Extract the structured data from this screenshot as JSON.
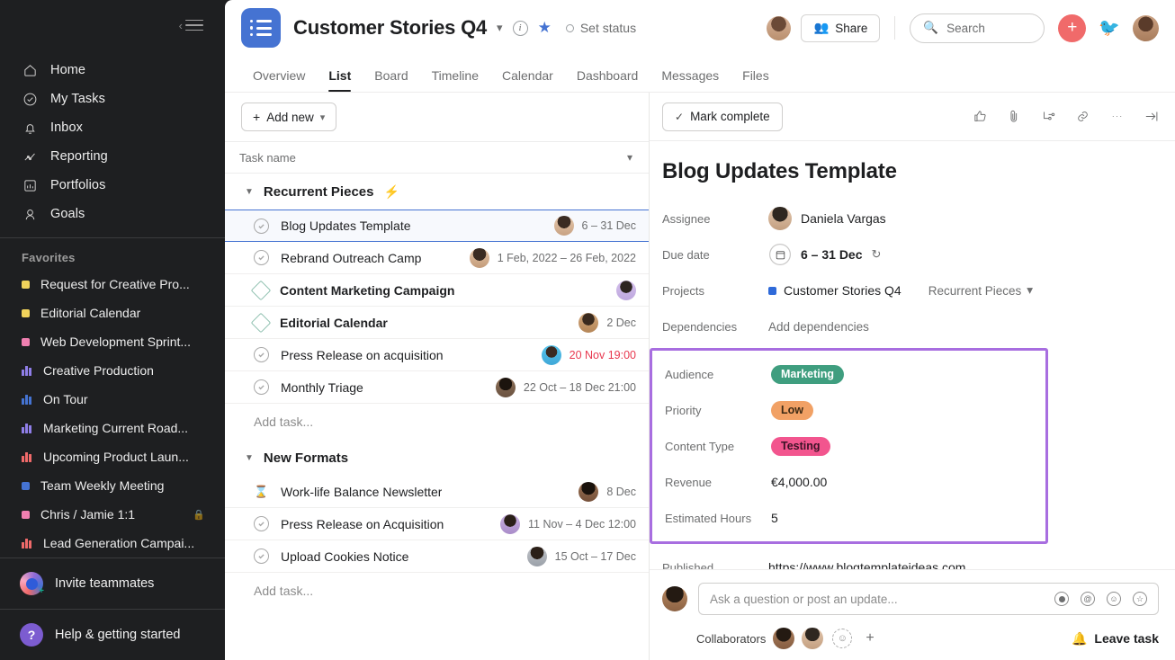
{
  "sidebar": {
    "collapse_label": "Collapse sidebar",
    "nav": [
      {
        "label": "Home",
        "icon": "home-icon"
      },
      {
        "label": "My Tasks",
        "icon": "check-circle-icon"
      },
      {
        "label": "Inbox",
        "icon": "bell-icon"
      },
      {
        "label": "Reporting",
        "icon": "chart-line-icon"
      },
      {
        "label": "Portfolios",
        "icon": "portfolio-icon"
      },
      {
        "label": "Goals",
        "icon": "goal-icon"
      }
    ],
    "favorites_title": "Favorites",
    "favorites": [
      {
        "label": "Request for Creative Pro...",
        "marker": "dot",
        "color": "#f1d35b"
      },
      {
        "label": "Editorial Calendar",
        "marker": "dot",
        "color": "#f1d35b"
      },
      {
        "label": "Web Development Sprint...",
        "marker": "dot",
        "color": "#ef7fb0"
      },
      {
        "label": "Creative Production",
        "marker": "bars",
        "color": "#8f7ee8"
      },
      {
        "label": "On Tour",
        "marker": "bars",
        "color": "#4573d2"
      },
      {
        "label": "Marketing Current Road...",
        "marker": "bars",
        "color": "#8f7ee8"
      },
      {
        "label": "Upcoming Product Laun...",
        "marker": "bars",
        "color": "#f06a6a"
      },
      {
        "label": "Team Weekly Meeting",
        "marker": "dot",
        "color": "#4573d2"
      },
      {
        "label": "Chris / Jamie 1:1",
        "marker": "dot",
        "color": "#ef7fb0",
        "locked": true
      },
      {
        "label": "Lead Generation Campai...",
        "marker": "bars",
        "color": "#f06a6a"
      }
    ],
    "invite_label": "Invite teammates",
    "help_label": "Help & getting started",
    "help_glyph": "?"
  },
  "header": {
    "project_title": "Customer Stories Q4",
    "set_status": "Set status",
    "share_label": "Share",
    "search_placeholder": "Search",
    "tabs": [
      {
        "label": "Overview",
        "active": false
      },
      {
        "label": "List",
        "active": true
      },
      {
        "label": "Board",
        "active": false
      },
      {
        "label": "Timeline",
        "active": false
      },
      {
        "label": "Calendar",
        "active": false
      },
      {
        "label": "Dashboard",
        "active": false
      },
      {
        "label": "Messages",
        "active": false
      },
      {
        "label": "Files",
        "active": false
      }
    ]
  },
  "list_pane": {
    "add_new_label": "Add new",
    "column_header": "Task name",
    "sections": [
      {
        "name": "Recurrent Pieces",
        "emoji": "⚡",
        "add_task_label": "Add task...",
        "tasks": [
          {
            "name": "Blog Updates Template",
            "icon": "check-circle-icon",
            "date": "6 – 31 Dec",
            "overdue": false,
            "selected": true,
            "bold": false,
            "avatar": "#caa88c"
          },
          {
            "name": "Rebrand Outreach Camp",
            "icon": "check-circle-icon",
            "date": "1 Feb, 2022 – 26 Feb, 2022",
            "overdue": false,
            "selected": false,
            "bold": false,
            "avatar": "#c9a184"
          },
          {
            "name": "Content Marketing Campaign",
            "icon": "milestone-diamond-icon",
            "date": "",
            "overdue": false,
            "selected": false,
            "bold": true,
            "avatar": "#cdb6e8"
          },
          {
            "name": "Editorial Calendar",
            "icon": "milestone-diamond-icon",
            "date": "2 Dec",
            "overdue": false,
            "selected": false,
            "bold": true,
            "avatar": "#c59a72"
          },
          {
            "name": "Press Release on acquisition",
            "icon": "check-circle-icon",
            "date": "20 Nov 19:00",
            "overdue": true,
            "selected": false,
            "bold": false,
            "avatar": "#4fc0e8"
          },
          {
            "name": "Monthly Triage",
            "icon": "check-circle-icon",
            "date": "22 Oct – 18 Dec 21:00",
            "overdue": false,
            "selected": false,
            "bold": false,
            "avatar": "#7a6a58"
          }
        ]
      },
      {
        "name": "New Formats",
        "emoji": "",
        "add_task_label": "Add task...",
        "tasks": [
          {
            "name": "Work-life Balance Newsletter",
            "icon": "hourglass-icon",
            "date": "8 Dec",
            "overdue": false,
            "selected": false,
            "bold": false,
            "avatar": "#6b4f3b"
          },
          {
            "name": "Press Release on Acquisition",
            "icon": "check-circle-icon",
            "date": "11 Nov – 4 Dec 12:00",
            "overdue": false,
            "selected": false,
            "bold": false,
            "avatar": "#c0a9d8"
          },
          {
            "name": "Upload Cookies Notice",
            "icon": "check-circle-icon",
            "date": "15 Oct – 17 Dec",
            "overdue": false,
            "selected": false,
            "bold": false,
            "avatar": "#b9bcc2"
          }
        ]
      }
    ]
  },
  "detail": {
    "mark_complete_label": "Mark complete",
    "task_title": "Blog Updates Template",
    "fields": {
      "assignee_label": "Assignee",
      "assignee_value": "Daniela Vargas",
      "due_date_label": "Due date",
      "due_date_value": "6 – 31 Dec",
      "projects_label": "Projects",
      "project_value": "Customer Stories Q4",
      "project_section": "Recurrent Pieces",
      "dependencies_label": "Dependencies",
      "dependencies_value": "Add dependencies"
    },
    "custom_fields": [
      {
        "label": "Audience",
        "value": "Marketing",
        "type": "pill",
        "pill_color": "green"
      },
      {
        "label": "Priority",
        "value": "Low",
        "type": "pill",
        "pill_color": "orange"
      },
      {
        "label": "Content Type",
        "value": "Testing",
        "type": "pill",
        "pill_color": "pink"
      },
      {
        "label": "Revenue",
        "value": "€4,000.00",
        "type": "text"
      },
      {
        "label": "Estimated Hours",
        "value": "5",
        "type": "text"
      }
    ],
    "published_label": "Published",
    "published_value": "https://www.blogtemplateideas.com",
    "comment_placeholder": "Ask a question or post an update...",
    "collaborators_label": "Collaborators",
    "leave_task_label": "Leave task",
    "highlight_color": "#a86ee0"
  }
}
